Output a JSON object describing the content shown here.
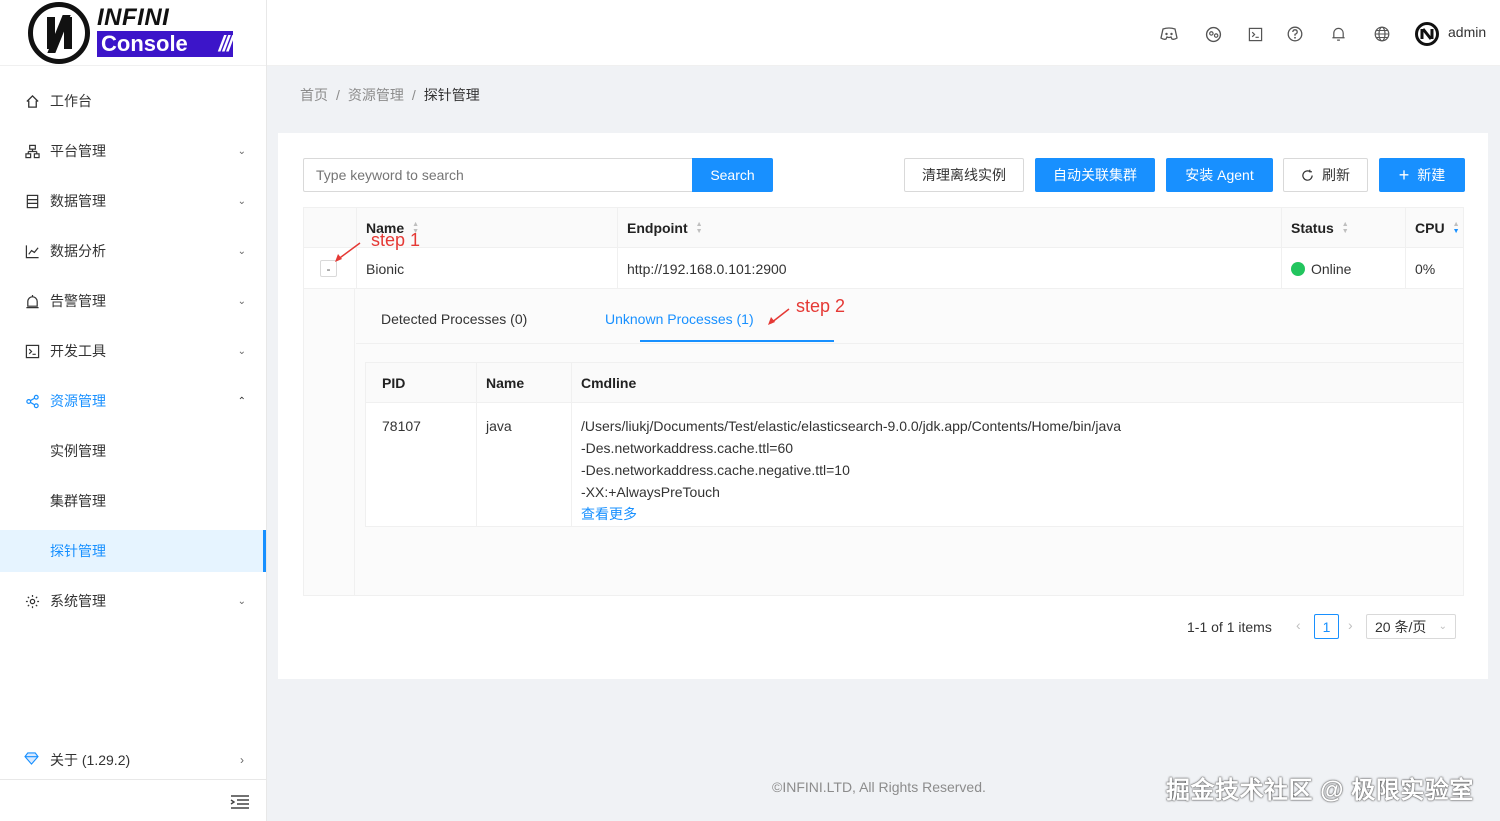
{
  "app": {
    "logo_top": "INFINI",
    "logo_bottom": "Console",
    "logo_stripes": "///"
  },
  "header": {
    "user": "admin",
    "icons": [
      "discord-icon",
      "community-icon",
      "console-icon",
      "help-icon",
      "bell-icon",
      "language-icon"
    ]
  },
  "sidebar": {
    "items": [
      {
        "label": "工作台",
        "icon": "home-icon"
      },
      {
        "label": "平台管理",
        "icon": "cluster-icon"
      },
      {
        "label": "数据管理",
        "icon": "database-icon"
      },
      {
        "label": "数据分析",
        "icon": "chart-icon"
      },
      {
        "label": "告警管理",
        "icon": "alarm-icon"
      },
      {
        "label": "开发工具",
        "icon": "code-icon"
      },
      {
        "label": "资源管理",
        "icon": "share-icon"
      },
      {
        "label": "实例管理",
        "icon": ""
      },
      {
        "label": "集群管理",
        "icon": ""
      },
      {
        "label": "探针管理",
        "icon": ""
      },
      {
        "label": "系统管理",
        "icon": "gear-icon"
      }
    ],
    "about": "关于 (1.29.2)"
  },
  "breadcrumb": {
    "items": [
      "首页",
      "资源管理",
      "探针管理"
    ],
    "separator": "/"
  },
  "toolbar": {
    "search_placeholder": "Type keyword to search",
    "search_label": "Search",
    "clear_offline": "清理离线实例",
    "auto_associate": "自动关联集群",
    "install_agent": "安装 Agent",
    "refresh": "刷新",
    "new": "新建"
  },
  "table": {
    "columns": [
      "Name",
      "Endpoint",
      "Status",
      "CPU"
    ],
    "rows": [
      {
        "name": "Bionic",
        "endpoint": "http://192.168.0.101:2900",
        "status": "Online",
        "cpu": "0%",
        "expand_symbol": "-"
      }
    ]
  },
  "expanded": {
    "tabs": [
      "Detected Processes (0)",
      "Unknown Processes (1)"
    ],
    "active_tab": 1,
    "process_columns": [
      "PID",
      "Name",
      "Cmdline"
    ],
    "processes": [
      {
        "pid": "78107",
        "name": "java",
        "cmdline": [
          "/Users/liukj/Documents/Test/elastic/elasticsearch-9.0.0/jdk.app/Contents/Home/bin/java",
          "-Des.networkaddress.cache.ttl=60",
          "-Des.networkaddress.cache.negative.ttl=10",
          "-XX:+AlwaysPreTouch"
        ],
        "more": "查看更多"
      }
    ]
  },
  "pagination": {
    "total_text": "1-1 of 1 items",
    "current_page": "1",
    "page_size": "20 条/页"
  },
  "annotations": {
    "step1": "step 1",
    "step2": "step 2",
    "color": "#e53935"
  },
  "footer": "©INFINI.LTD, All Rights Reserved.",
  "watermark": "掘金技术社区 @ 极限实验室",
  "colors": {
    "primary": "#1890ff",
    "online": "#22c55e",
    "brand": "#3c15c9"
  }
}
